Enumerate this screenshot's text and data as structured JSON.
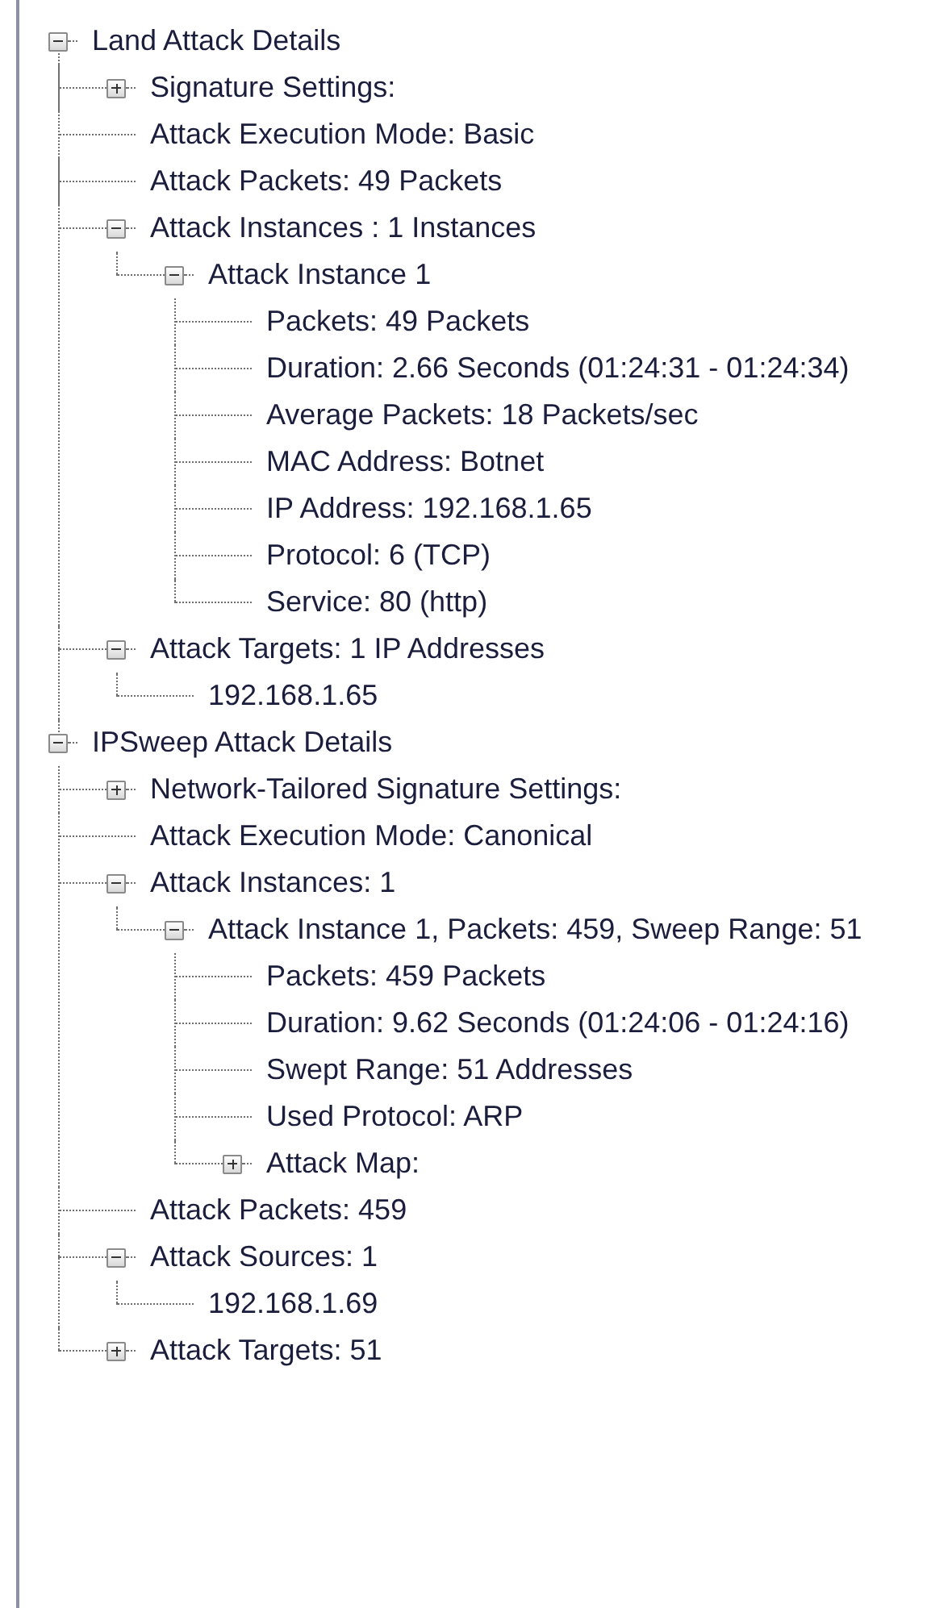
{
  "tree": [
    {
      "label": "Land Attack Details",
      "expanded": true,
      "children": [
        {
          "label": "Signature Settings:",
          "expanded": false
        },
        {
          "label": "Attack Execution Mode: Basic"
        },
        {
          "label": "Attack Packets: 49 Packets"
        },
        {
          "label": "Attack Instances : 1 Instances",
          "expanded": true,
          "children": [
            {
              "label": "Attack Instance 1",
              "expanded": true,
              "children": [
                {
                  "label": "Packets: 49 Packets"
                },
                {
                  "label": "Duration: 2.66 Seconds (01:24:31 - 01:24:34)"
                },
                {
                  "label": "Average Packets: 18 Packets/sec"
                },
                {
                  "label": "MAC Address: Botnet"
                },
                {
                  "label": "IP Address: 192.168.1.65"
                },
                {
                  "label": "Protocol: 6 (TCP)"
                },
                {
                  "label": "Service: 80 (http)"
                }
              ]
            }
          ]
        },
        {
          "label": "Attack Targets: 1 IP Addresses",
          "expanded": true,
          "children": [
            {
              "label": "192.168.1.65"
            }
          ]
        }
      ]
    },
    {
      "label": "IPSweep Attack Details",
      "expanded": true,
      "children": [
        {
          "label": "Network-Tailored Signature Settings:",
          "expanded": false
        },
        {
          "label": "Attack Execution Mode: Canonical"
        },
        {
          "label": "Attack Instances: 1",
          "expanded": true,
          "children": [
            {
              "label": "Attack Instance 1, Packets: 459, Sweep Range: 51",
              "expanded": true,
              "children": [
                {
                  "label": "Packets: 459 Packets"
                },
                {
                  "label": "Duration: 9.62 Seconds (01:24:06 - 01:24:16)"
                },
                {
                  "label": "Swept Range: 51 Addresses"
                },
                {
                  "label": "Used Protocol: ARP"
                },
                {
                  "label": "Attack Map:",
                  "expanded": false
                }
              ]
            }
          ]
        },
        {
          "label": "Attack Packets: 459"
        },
        {
          "label": "Attack Sources: 1",
          "expanded": true,
          "children": [
            {
              "label": "192.168.1.69"
            }
          ]
        },
        {
          "label": "Attack Targets: 51",
          "expanded": false
        }
      ]
    }
  ]
}
